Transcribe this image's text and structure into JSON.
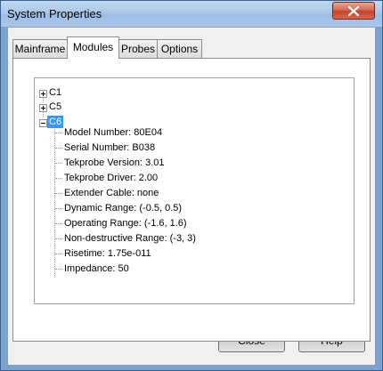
{
  "window": {
    "title": "System Properties"
  },
  "tabs": [
    {
      "label": "Mainframe"
    },
    {
      "label": "Modules",
      "active": true
    },
    {
      "label": "Probes"
    },
    {
      "label": "Options"
    }
  ],
  "tree": {
    "nodes": [
      {
        "label": "C1",
        "expanded": false
      },
      {
        "label": "C5",
        "expanded": false
      },
      {
        "label": "C6",
        "expanded": true,
        "selected": true,
        "children": [
          "Model Number: 80E04",
          "Serial Number: B038",
          "Tekprobe Version: 3.01",
          "Tekprobe Driver: 2.00",
          "Extender Cable: none",
          "Dynamic Range: (-0.5, 0.5)",
          "Operating Range: (-1.6, 1.6)",
          "Non-destructive Range: (-3, 3)",
          "Risetime: 1.75e-011",
          "Impedance: 50"
        ]
      }
    ]
  },
  "buttons": {
    "close": "Close",
    "help": "Help"
  },
  "colors": {
    "selection": "#3399ff",
    "close_button": "#c4432c"
  }
}
